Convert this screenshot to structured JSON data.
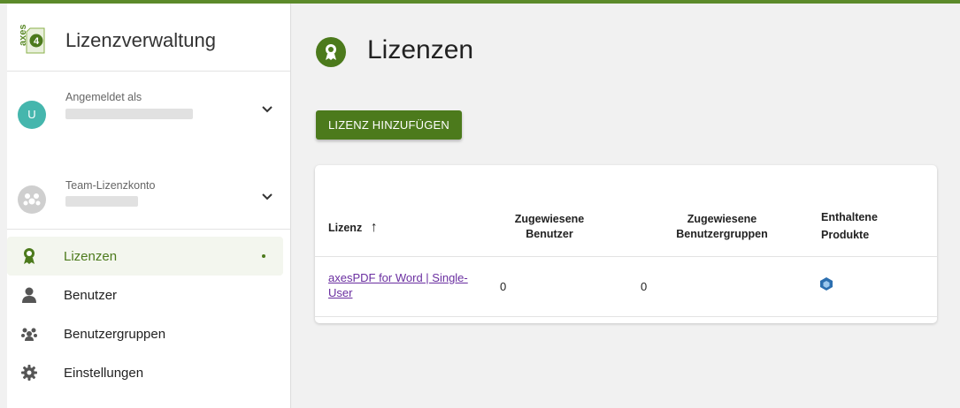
{
  "app": {
    "logo_text": "axes",
    "logo_number": "4",
    "title": "Lizenzverwaltung",
    "accent_color": "#4c7a1c"
  },
  "accounts": {
    "user": {
      "avatar_letter": "U",
      "label": "Angemeldet als",
      "avatar_color": "#45b6ad"
    },
    "team": {
      "label": "Team-Lizenzkonto",
      "avatar_color": "#cfcfcf"
    }
  },
  "nav": {
    "items": [
      {
        "label": "Lizenzen",
        "icon": "award-icon",
        "active": true
      },
      {
        "label": "Benutzer",
        "icon": "user-icon"
      },
      {
        "label": "Benutzergruppen",
        "icon": "users-icon"
      },
      {
        "label": "Einstellungen",
        "icon": "gear-icon"
      }
    ]
  },
  "page": {
    "title": "Lizenzen",
    "add_button": "LIZENZ HINZUFÜGEN"
  },
  "table": {
    "headers": {
      "license": "Lizenz",
      "sort_indicator": "↑",
      "assigned_users": "Zugewiesene Benutzer",
      "assigned_groups": "Zugewiesene Benutzergruppen",
      "products": "Enthaltene Produkte"
    },
    "rows": [
      {
        "license": "axesPDF for Word | Single-User",
        "assigned_users": "0",
        "assigned_groups": "0",
        "product_icon": "product-cube-icon"
      }
    ]
  }
}
